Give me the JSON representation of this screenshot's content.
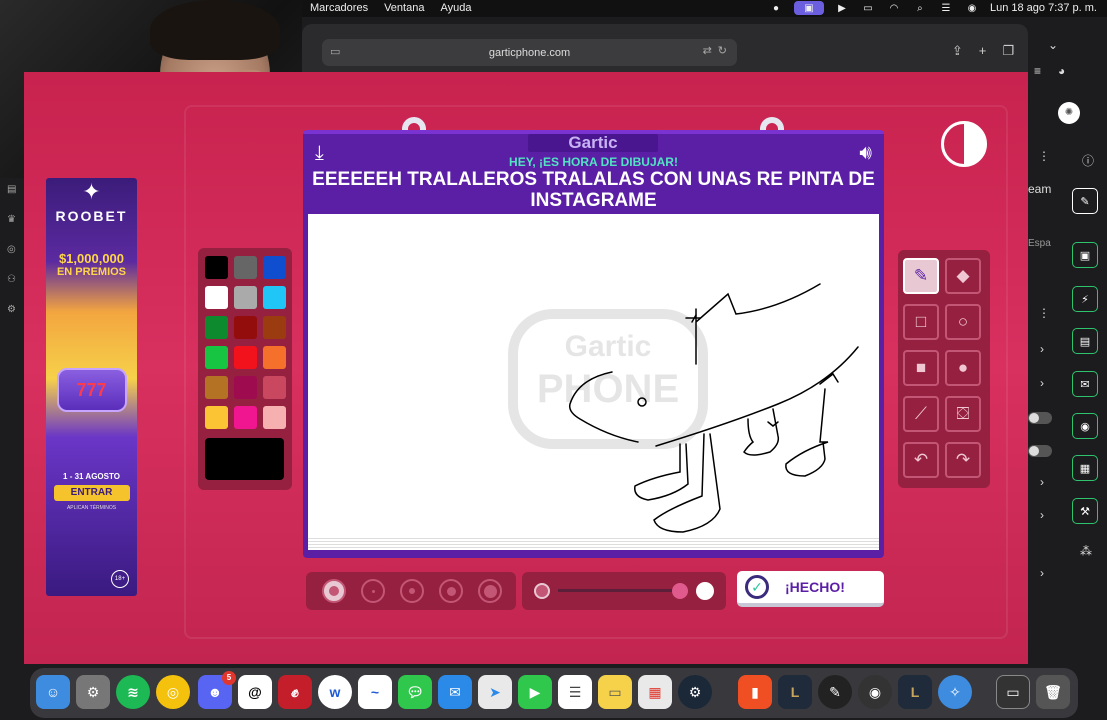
{
  "menubar": {
    "items": [
      "Marcadores",
      "Ventana",
      "Ayuda"
    ],
    "datetime": "Lun 18 ago  7:37 p. m."
  },
  "browser": {
    "url": "garticphone.com"
  },
  "ad": {
    "brand": "ROOBET",
    "amount": "$1,000,000",
    "subtitle": "EN PREMIOS",
    "slot": "777",
    "dates": "1 - 31 AGOSTO",
    "cta": "ENTRAR",
    "terms": "APLICAN TÉRMINOS",
    "age": "18+"
  },
  "game": {
    "logo": "Gartic",
    "subtitle": "HEY, ¡ES HORA DE DIBUJAR!",
    "theme": "EEEEEEH TRALALEROS TRALALAS CON UNAS RE PINTA DE INSTAGRAME",
    "watermark_top": "Gartic",
    "watermark_bottom": "PHONE",
    "done_label": "¡HECHO!",
    "palette": [
      "#000000",
      "#666666",
      "#0f4fcf",
      "#ffffff",
      "#aaaaaa",
      "#20c6f5",
      "#0d8a2e",
      "#940d0d",
      "#9a3c10",
      "#18c543",
      "#f2121c",
      "#f5702a",
      "#b47224",
      "#9e0b4f",
      "#c9485f",
      "#fbc434",
      "#ef1690",
      "#f7b0b0"
    ],
    "selected_color": "#000000",
    "opacity": 1.0
  },
  "right_panel": {
    "text1": "eam",
    "text2": "Espa"
  },
  "dock": {
    "discord_badge": "5"
  }
}
